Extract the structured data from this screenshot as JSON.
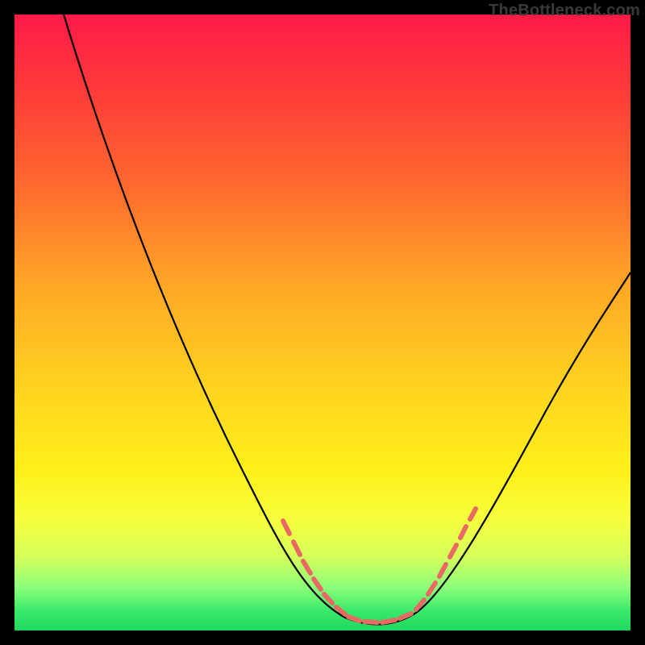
{
  "watermark": "TheBottleneck.com",
  "chart_data": {
    "type": "line",
    "title": "",
    "xlabel": "",
    "ylabel": "",
    "xlim": [
      0,
      100
    ],
    "ylim": [
      0,
      100
    ],
    "series": [
      {
        "name": "bottleneck-curve",
        "x": [
          8,
          12,
          16,
          20,
          24,
          28,
          32,
          36,
          40,
          44,
          48,
          50,
          52,
          54,
          56,
          58,
          60,
          62,
          64,
          66,
          68,
          72,
          76,
          80,
          84,
          88,
          92,
          96,
          100
        ],
        "y": [
          100,
          92,
          84,
          76,
          68,
          60,
          52,
          44,
          36,
          28,
          20,
          14,
          9,
          5,
          2,
          0,
          0,
          1,
          3,
          6,
          10,
          18,
          26,
          33,
          40,
          46,
          52,
          57,
          61
        ]
      }
    ],
    "highlight_dashes": {
      "description": "salmon dashed segments near valley where bottleneck < ~20",
      "left_range_x": [
        44,
        56
      ],
      "right_range_x": [
        62,
        72
      ]
    },
    "gradient_meaning": "background color encodes bottleneck severity: green (none) at bottom to red (severe) at top"
  }
}
